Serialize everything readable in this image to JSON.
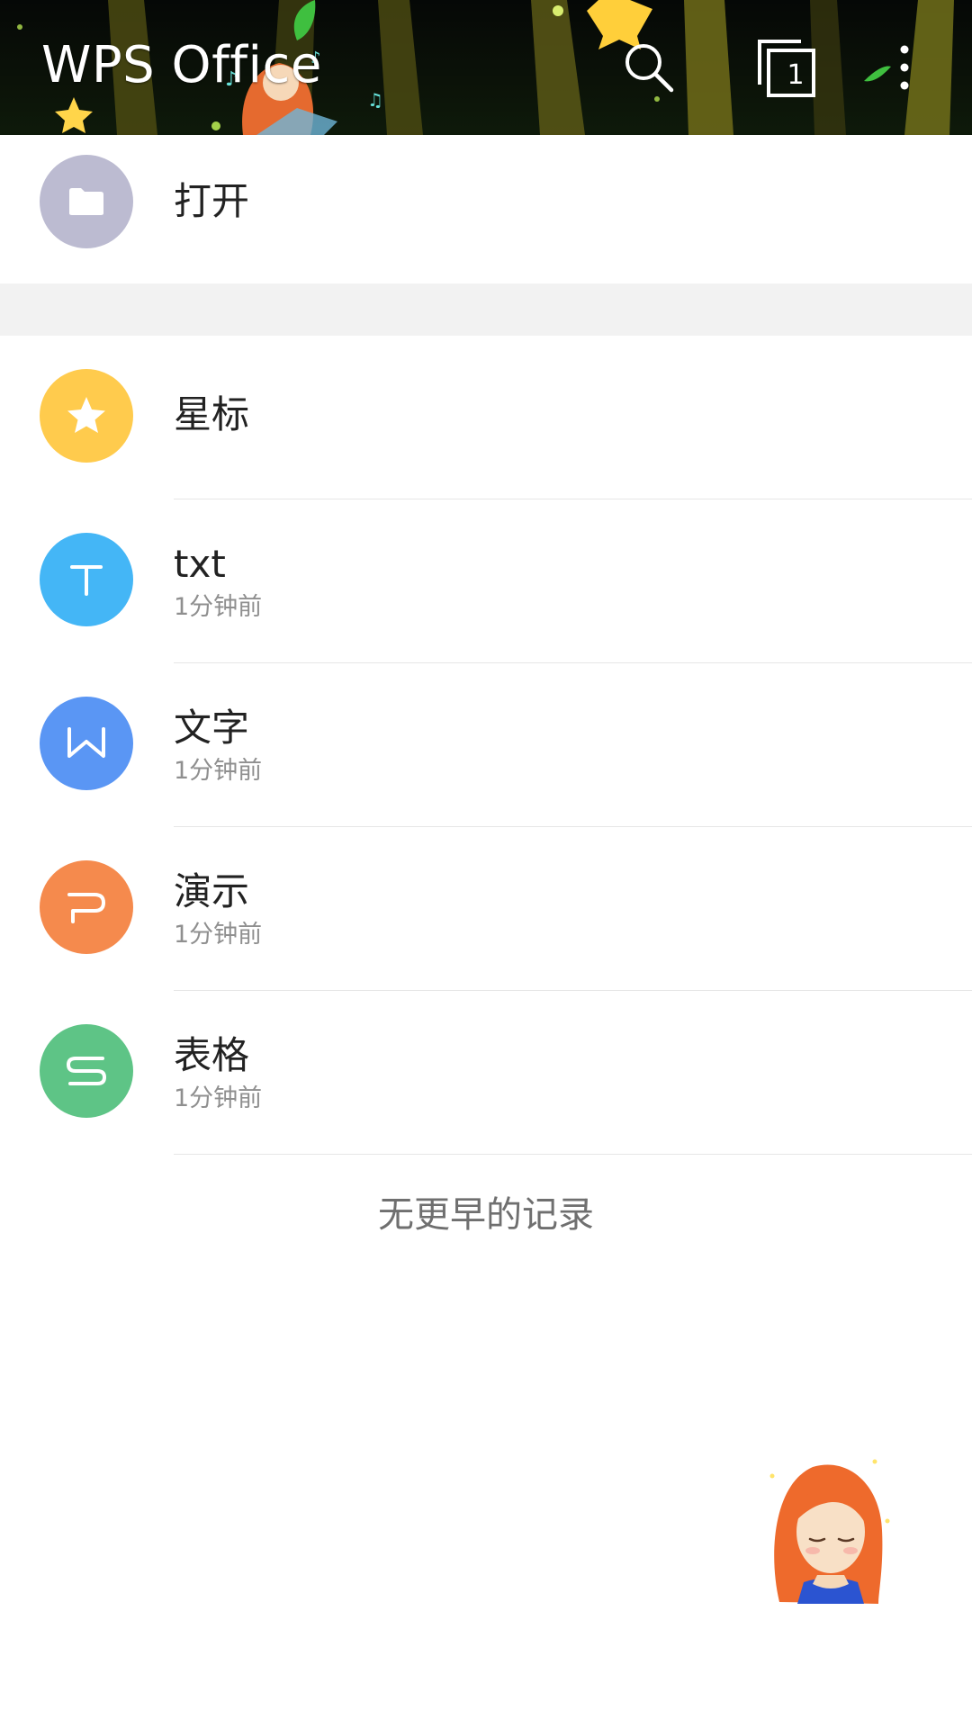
{
  "header": {
    "title": "WPS Office",
    "tab_count": "1",
    "search_icon": "search-icon",
    "tabs_icon": "document-tabs-icon",
    "more_icon": "more-vert-icon"
  },
  "open": {
    "label": "打开",
    "icon": "folder-icon",
    "color": "#bcbbd1"
  },
  "list": [
    {
      "title": "星标",
      "subtitle": "",
      "icon": "star-icon",
      "color": "#ffcb4d"
    },
    {
      "title": "txt",
      "subtitle": "1分钟前",
      "icon": "txt-icon",
      "color": "#44b6f6"
    },
    {
      "title": "文字",
      "subtitle": "1分钟前",
      "icon": "writer-icon",
      "color": "#5a96f4"
    },
    {
      "title": "演示",
      "subtitle": "1分钟前",
      "icon": "presentation-icon",
      "color": "#f58a4d"
    },
    {
      "title": "表格",
      "subtitle": "1分钟前",
      "icon": "spreadsheet-icon",
      "color": "#5ec486"
    }
  ],
  "footer_note": "无更早的记录",
  "colors": {
    "header_bg": "#0b1208",
    "divider": "#e6e6e6",
    "section_gap": "#f2f2f2"
  }
}
